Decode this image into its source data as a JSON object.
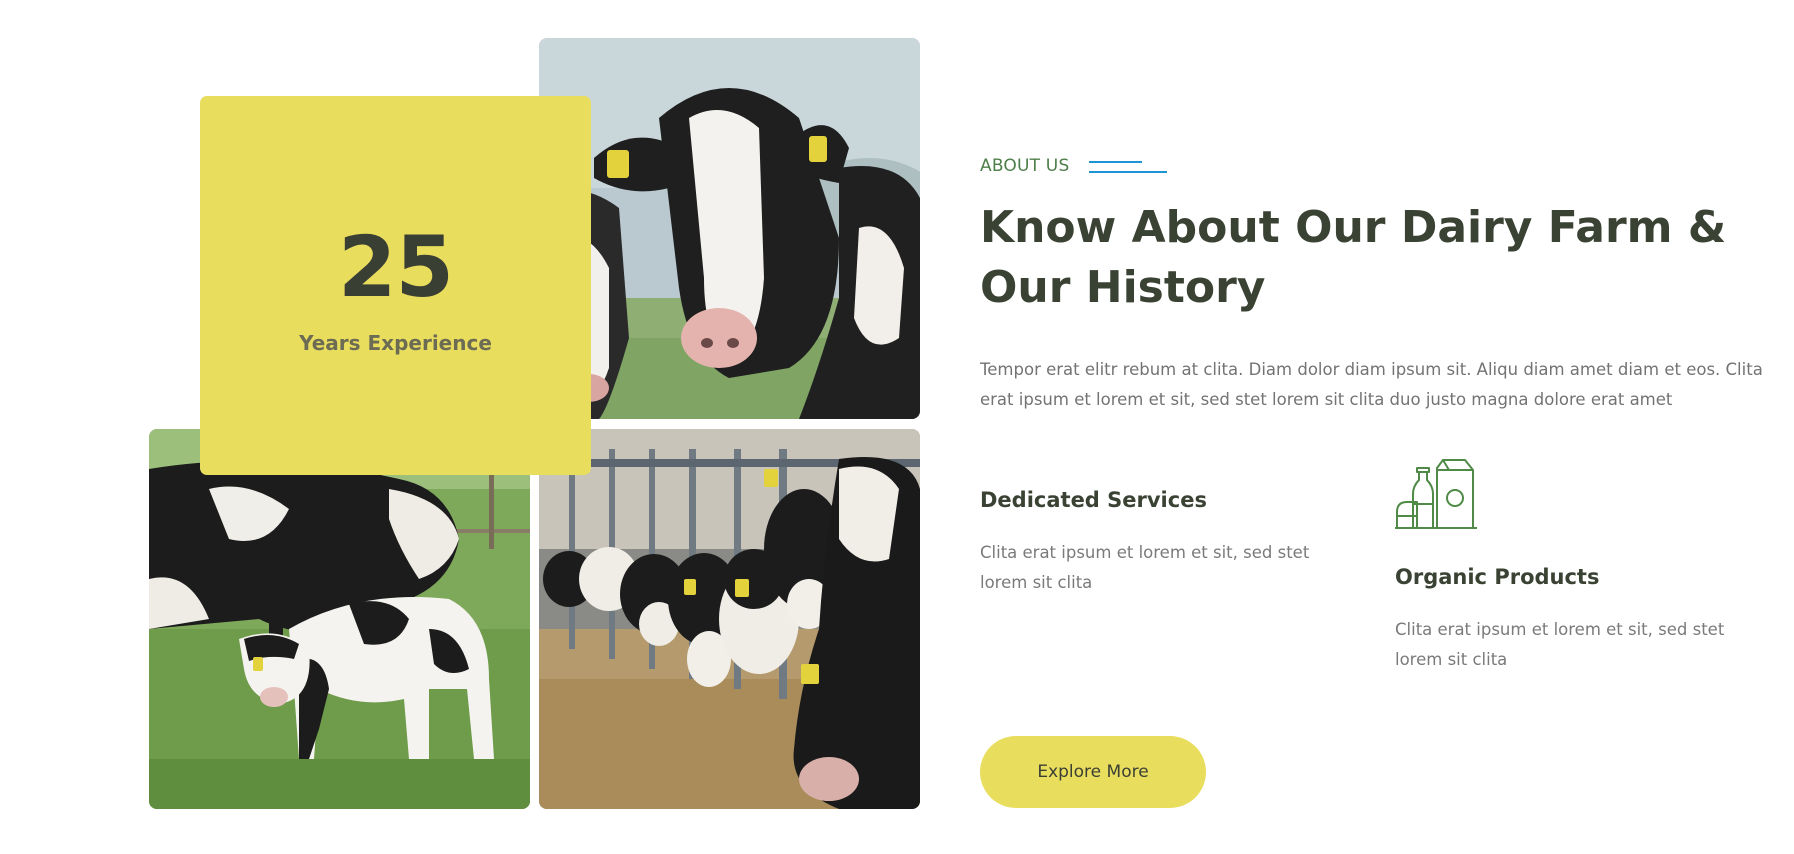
{
  "experience": {
    "years": "25",
    "label": "Years Experience"
  },
  "about": {
    "eyebrow": "ABOUT US",
    "heading": "Know About Our Dairy Farm & Our History",
    "intro": "Tempor erat elitr rebum at clita. Diam dolor diam ipsum sit. Aliqu diam amet diam et eos. Clita erat ipsum et lorem et sit, sed stet lorem sit clita duo justo magna dolore erat amet"
  },
  "features": [
    {
      "title": "Dedicated Services",
      "text": "Clita erat ipsum et lorem et sit, sed stet lorem sit clita"
    },
    {
      "title": "Organic Products",
      "text": "Clita erat ipsum et lorem et sit, sed stet lorem sit clita",
      "icon": "dairy-products-icon"
    }
  ],
  "cta": {
    "label": "Explore More"
  },
  "images": [
    {
      "name": "cow-closeup-photo"
    },
    {
      "name": "cow-and-calf-photo"
    },
    {
      "name": "cows-feeding-barn-photo"
    }
  ],
  "colors": {
    "accent_yellow": "#e9dd5e",
    "heading_dark": "#3a4233",
    "eyebrow_green": "#4e7f4b",
    "line_blue": "#1e94d6",
    "body_gray": "#737373"
  }
}
